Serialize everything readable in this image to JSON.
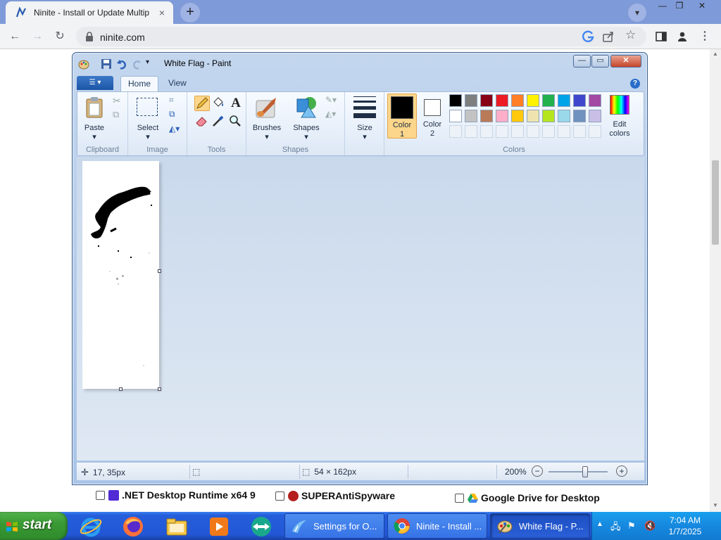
{
  "browser": {
    "tab_title": "Ninite - Install or Update Multip",
    "tab_close": "×",
    "new_tab": "+",
    "url": "ninite.com",
    "window_controls": {
      "minimize": "—",
      "restore": "❐",
      "close": "✕"
    }
  },
  "page": {
    "items": [
      {
        "label": ".NET Desktop Runtime x64 9",
        "icon": "dotnet-icon",
        "color": "#512bd4"
      },
      {
        "label": "SUPERAntiSpyware",
        "icon": "superantispyware-icon",
        "color": "#b51e1e"
      },
      {
        "label": "Google Drive for Desktop",
        "icon": "google-drive-icon",
        "color": "#1fa463"
      }
    ]
  },
  "paint": {
    "title": "White Flag - Paint",
    "tabs": [
      "Home",
      "View"
    ],
    "active_tab": "Home",
    "help": "?",
    "groups": {
      "clipboard": {
        "label": "Clipboard",
        "paste": "Paste"
      },
      "image": {
        "label": "Image",
        "select": "Select"
      },
      "tools": {
        "label": "Tools"
      },
      "shapes": {
        "label": "Shapes",
        "brushes": "Brushes",
        "shapes": "Shapes"
      },
      "size": {
        "label": "Size"
      },
      "colors": {
        "label": "Colors",
        "color1_l1": "Color",
        "color1_l2": "1",
        "color2_l1": "Color",
        "color2_l2": "2",
        "edit_l1": "Edit",
        "edit_l2": "colors"
      }
    },
    "color1": "#000000",
    "color2": "#ffffff",
    "palette": [
      "#000000",
      "#7f7f7f",
      "#880015",
      "#ed1c24",
      "#ff7f27",
      "#fff200",
      "#22b14c",
      "#00a2e8",
      "#3f48cc",
      "#a349a4",
      "#ffffff",
      "#c3c3c3",
      "#b97a57",
      "#ffaec9",
      "#ffc90e",
      "#efe4b0",
      "#b5e61d",
      "#99d9ea",
      "#7092be",
      "#c8bfe7"
    ],
    "status": {
      "cursor_pos": "17, 35px",
      "image_size": "54 × 162px",
      "zoom": "200%",
      "zoom_out": "−",
      "zoom_in": "+",
      "zoom_level": 0.62
    }
  },
  "taskbar": {
    "start_label": "start",
    "tasks": [
      {
        "label": "Settings for O...",
        "icon": "settings-icon"
      },
      {
        "label": "Ninite - Install ...",
        "icon": "chrome-icon"
      },
      {
        "label": "White Flag - P...",
        "icon": "paint-icon"
      }
    ],
    "time": "7:04 AM",
    "date": "1/7/2025"
  }
}
